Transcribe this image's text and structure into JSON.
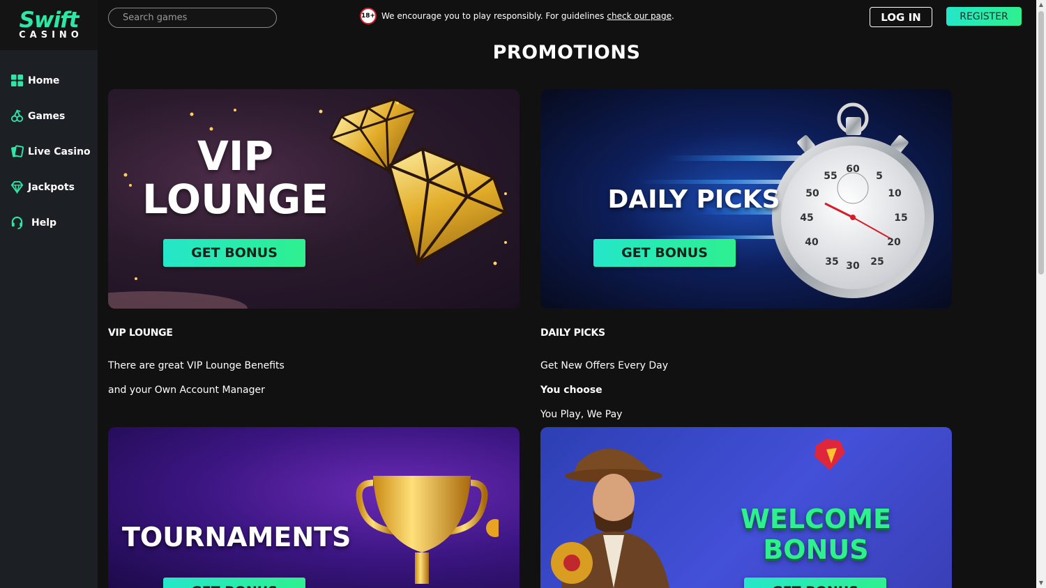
{
  "brand": {
    "name": "Swift",
    "sub": "CASINO"
  },
  "sidebar": {
    "items": [
      {
        "label": "Home",
        "icon": "home-grid-icon"
      },
      {
        "label": "Games",
        "icon": "cherries-icon"
      },
      {
        "label": "Live Casino",
        "icon": "cards-icon"
      },
      {
        "label": "Jackpots",
        "icon": "diamond-icon"
      },
      {
        "label": "Help",
        "icon": "headset-icon"
      }
    ]
  },
  "header": {
    "search_placeholder": "Search games",
    "age_badge": "18+",
    "notice_text": "We encourage you to play responsibly. For guidelines",
    "notice_link": "check our page",
    "notice_end": ".",
    "login_label": "LOG IN",
    "register_label": "REGISTER"
  },
  "page": {
    "title": "PROMOTIONS"
  },
  "promotions": [
    {
      "banner_title_line1": "VIP",
      "banner_title_line2": "LOUNGE",
      "button": "GET BONUS",
      "heading": "VIP LOUNGE",
      "lines": [
        "There are great VIP Lounge Benefits",
        "and your Own Account Manager"
      ]
    },
    {
      "banner_title": "DAILY PICKS",
      "button": "GET BONUS",
      "heading": "DAILY PICKS",
      "lines": [
        "Get New Offers Every Day",
        "You choose",
        "You Play, We Pay"
      ]
    },
    {
      "banner_title": "TOURNAMENTS",
      "button": "GET BONUS"
    },
    {
      "banner_title": "WELCOME BONUS",
      "button": "GET BONUS"
    }
  ],
  "stopwatch_numbers": [
    "60",
    "5",
    "10",
    "15",
    "20",
    "25",
    "30",
    "35",
    "40",
    "45",
    "50",
    "55"
  ],
  "colors": {
    "accent": "#2ee6a6",
    "background": "#111111",
    "sidebar": "#1c1f24",
    "warning_red": "#d21f2c"
  }
}
